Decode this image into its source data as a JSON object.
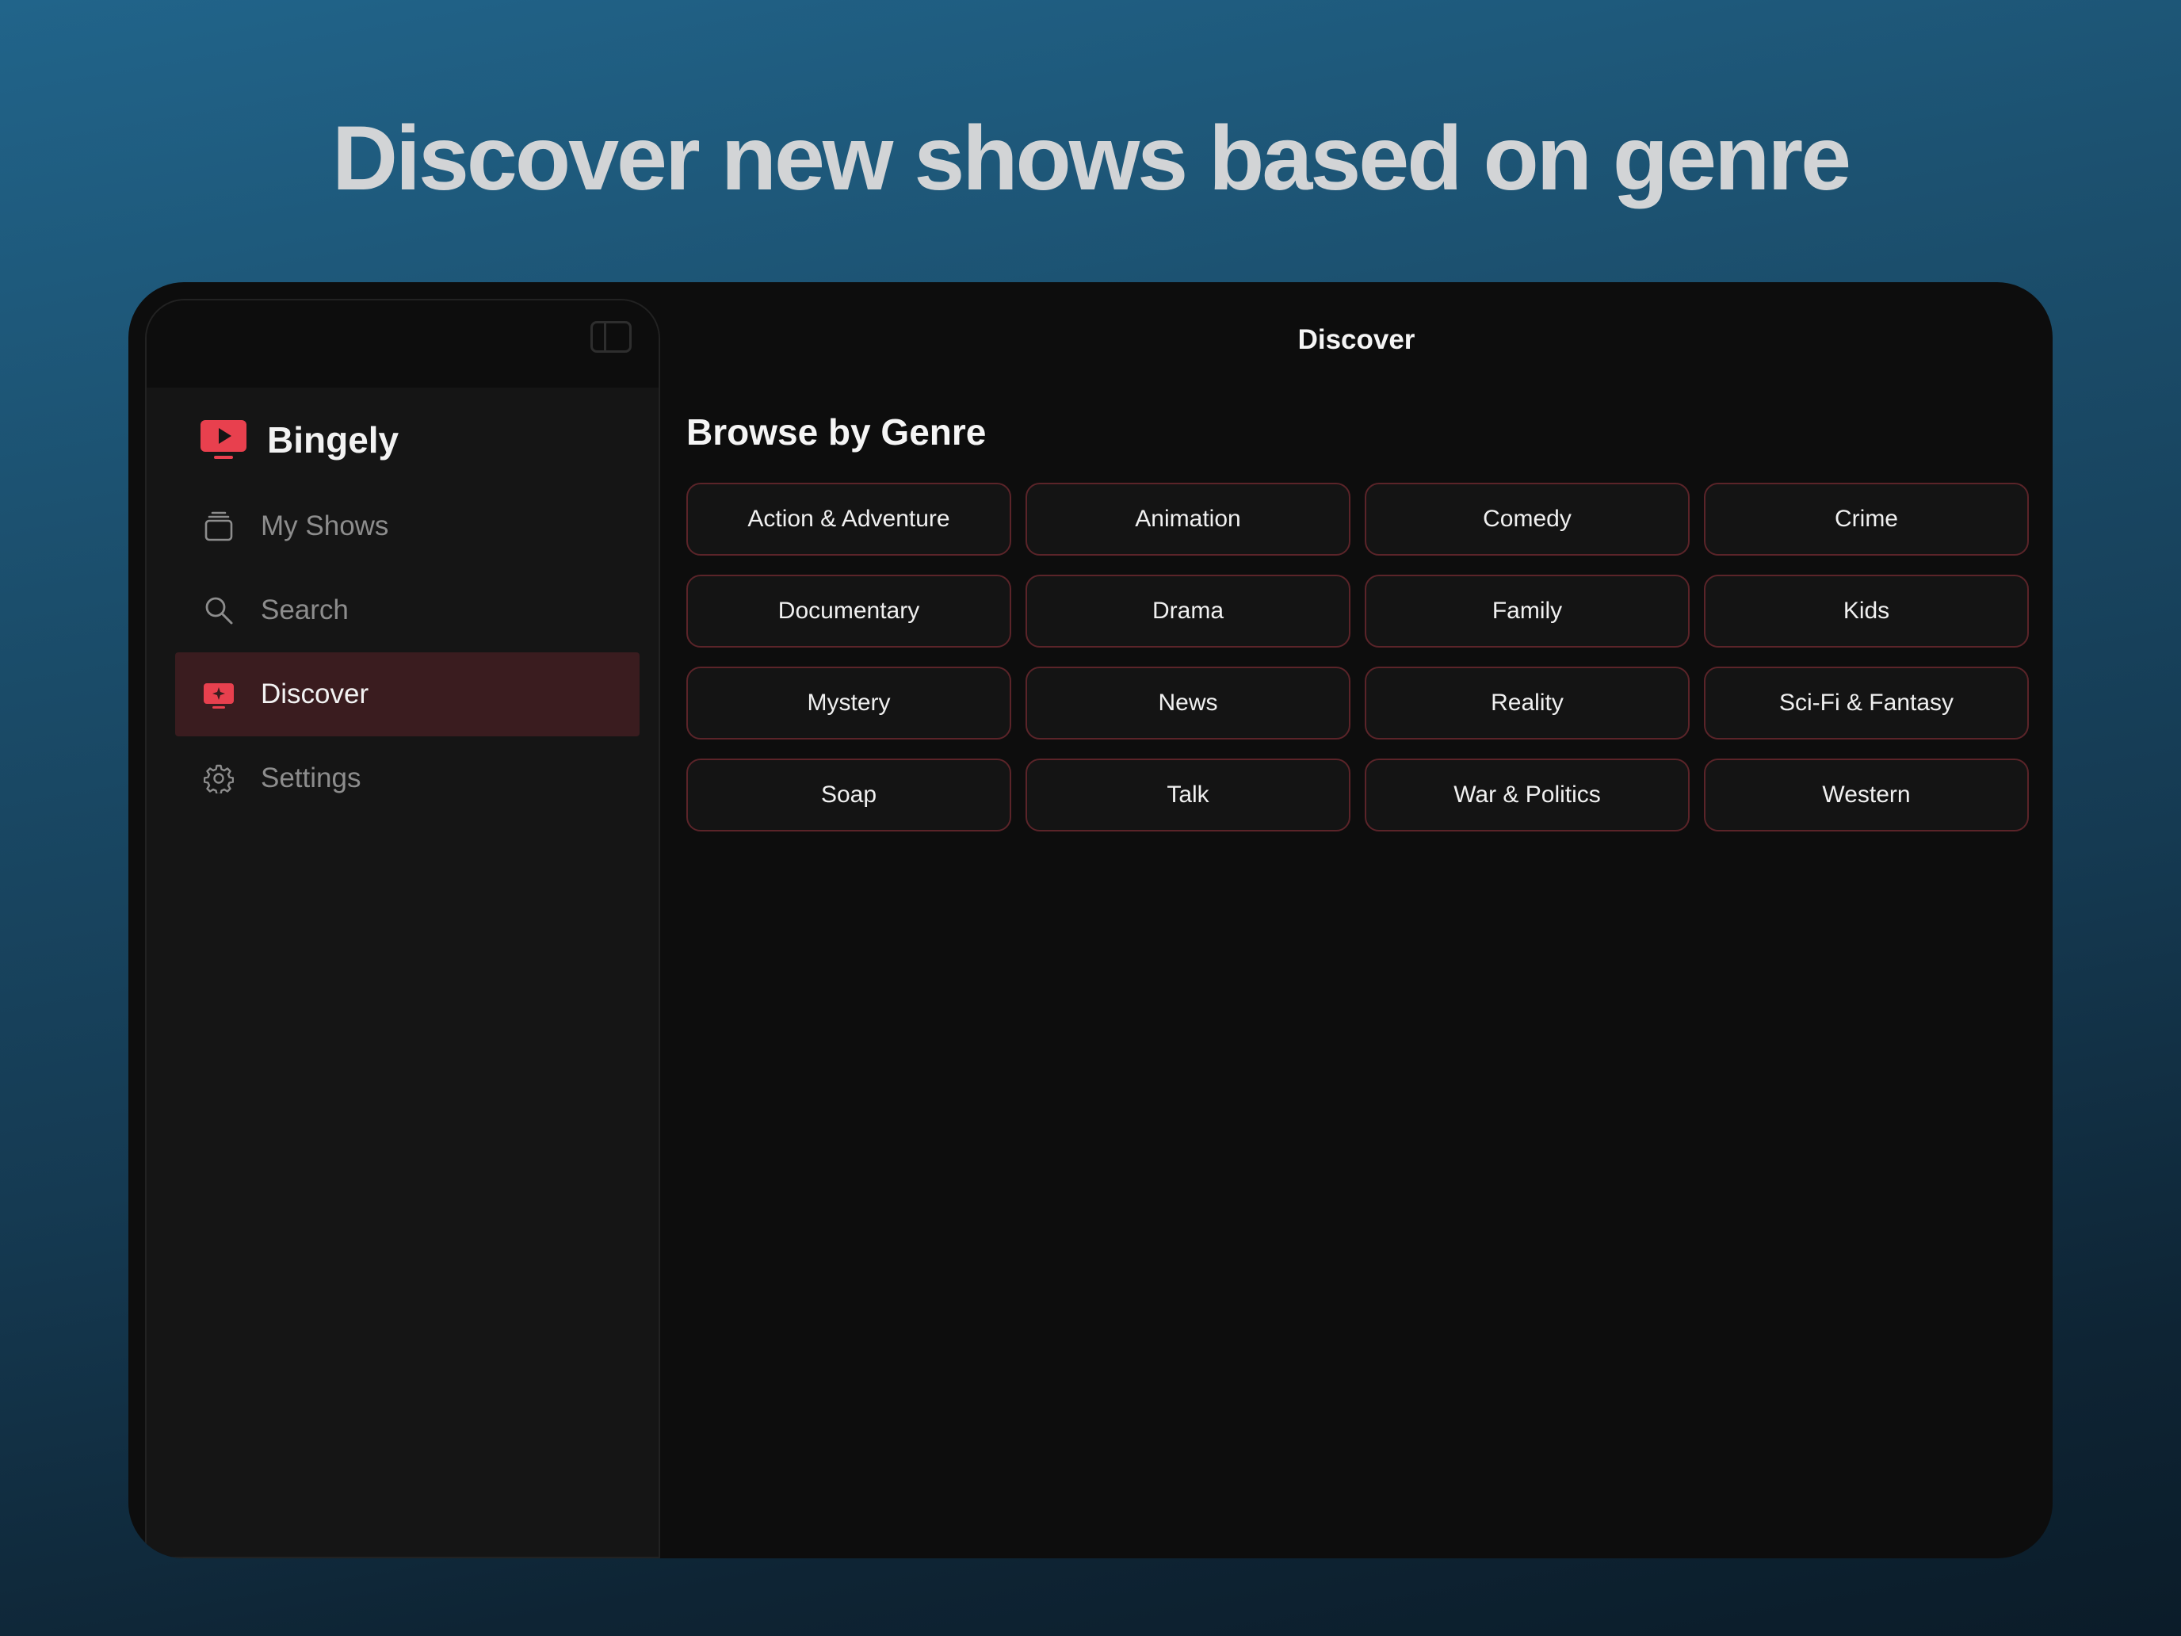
{
  "headline": "Discover new shows based on genre",
  "app": {
    "name": "Bingely",
    "accent": "#e8404e"
  },
  "sidebar": {
    "toggle_icon": "sidebar-toggle-icon",
    "items": [
      {
        "label": "My Shows",
        "icon": "stack-icon",
        "active": false
      },
      {
        "label": "Search",
        "icon": "search-icon",
        "active": false
      },
      {
        "label": "Discover",
        "icon": "tv-sparkle-icon",
        "active": true
      },
      {
        "label": "Settings",
        "icon": "gear-icon",
        "active": false
      }
    ]
  },
  "main": {
    "title": "Discover",
    "section_title": "Browse by Genre",
    "genres": [
      "Action & Adventure",
      "Animation",
      "Comedy",
      "Crime",
      "Documentary",
      "Drama",
      "Family",
      "Kids",
      "Mystery",
      "News",
      "Reality",
      "Sci-Fi & Fantasy",
      "Soap",
      "Talk",
      "War & Politics",
      "Western"
    ]
  }
}
